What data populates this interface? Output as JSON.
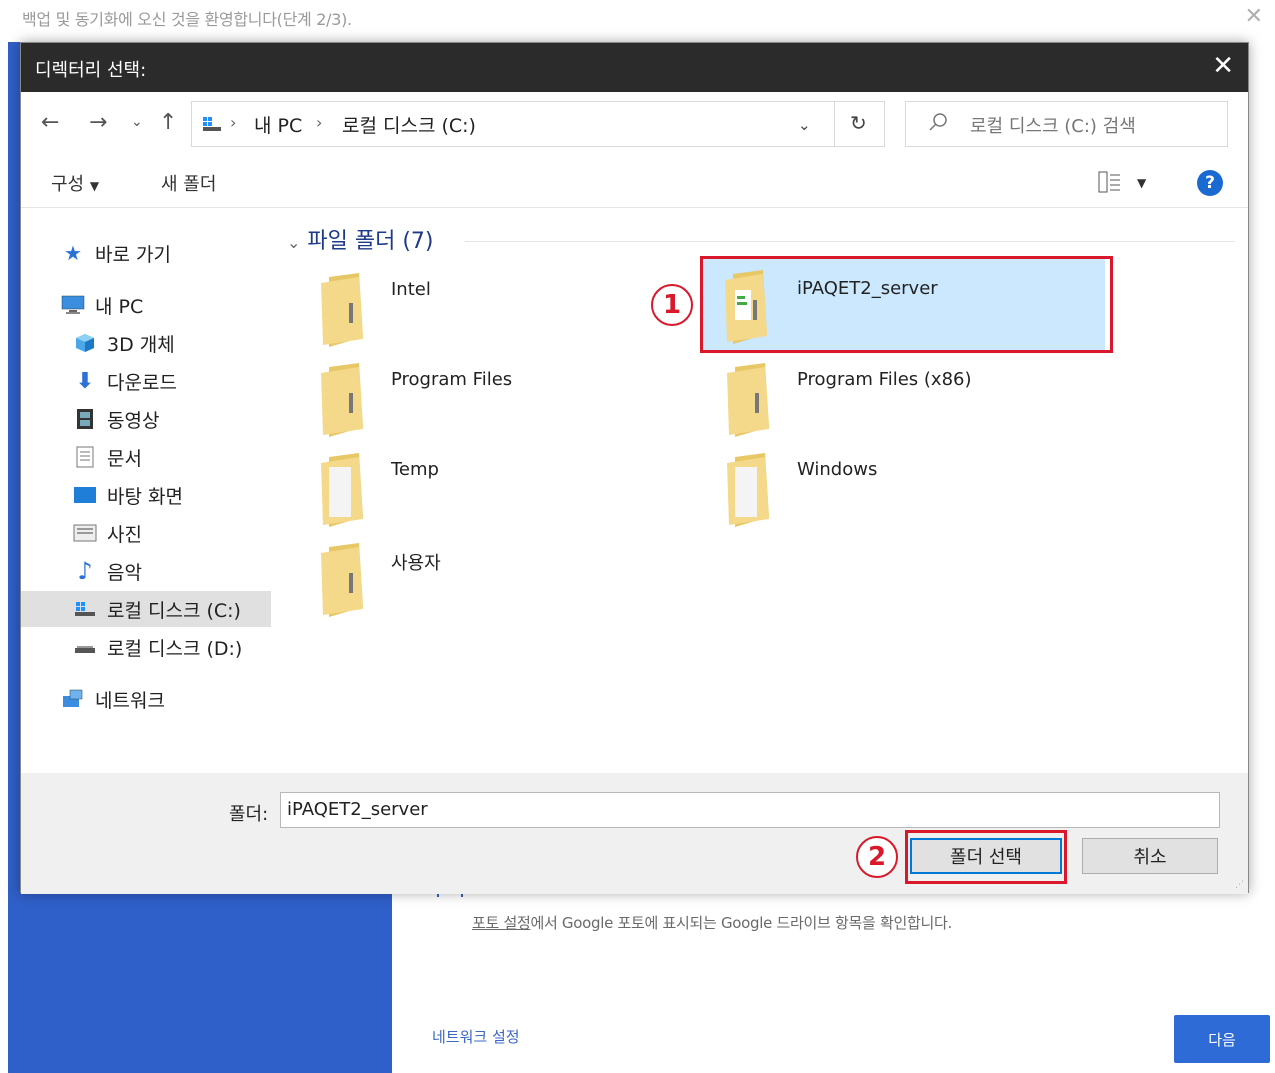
{
  "background": {
    "title": "백업 및 동기화에 오신 것을 환영합니다(단계 2/3).",
    "close": "✕",
    "google_line_link": "포토 설정",
    "google_line_rest": "에서 Google 포토에 표시되는 Google 드라이브 항목을 확인합니다.",
    "network_link": "네트워크 설정",
    "next_button": "다음"
  },
  "dialog": {
    "title": "디렉터리 선택:",
    "close": "✕",
    "nav": {
      "back": "←",
      "forward": "→",
      "recent": "⌄",
      "up": "↑"
    },
    "breadcrumb": [
      "내 PC",
      "로컬 디스크 (C:)"
    ],
    "breadcrumb_sep": "›",
    "address_dropdown": "⌄",
    "refresh": "↻",
    "search_placeholder": "로컬 디스크 (C:) 검색",
    "toolbar": {
      "organize": "구성",
      "new_folder": "새 폴더",
      "help": "?"
    },
    "sidebar": [
      {
        "label": "바로 가기",
        "icon": "star-icon"
      },
      {
        "label": "내 PC",
        "icon": "computer-icon"
      },
      {
        "label": "3D 개체",
        "icon": "cube-icon"
      },
      {
        "label": "다운로드",
        "icon": "download-icon"
      },
      {
        "label": "동영상",
        "icon": "video-icon"
      },
      {
        "label": "문서",
        "icon": "document-icon"
      },
      {
        "label": "바탕 화면",
        "icon": "desktop-icon"
      },
      {
        "label": "사진",
        "icon": "picture-icon"
      },
      {
        "label": "음악",
        "icon": "music-icon"
      },
      {
        "label": "로컬 디스크 (C:)",
        "icon": "drive-icon"
      },
      {
        "label": "로컬 디스크 (D:)",
        "icon": "drive-icon"
      },
      {
        "label": "네트워크",
        "icon": "network-icon"
      }
    ],
    "group_header": "파일 폴더 (7)",
    "group_chevron": "⌄",
    "folders": [
      "Intel",
      "iPAQET2_server",
      "Program Files",
      "Program Files (x86)",
      "Temp",
      "Windows",
      "사용자"
    ],
    "folder_label": "폴더:",
    "folder_value": "iPAQET2_server",
    "select_button": "폴더 선택",
    "cancel_button": "취소",
    "callout_1": "1",
    "callout_2": "2",
    "grip": "⋰"
  }
}
